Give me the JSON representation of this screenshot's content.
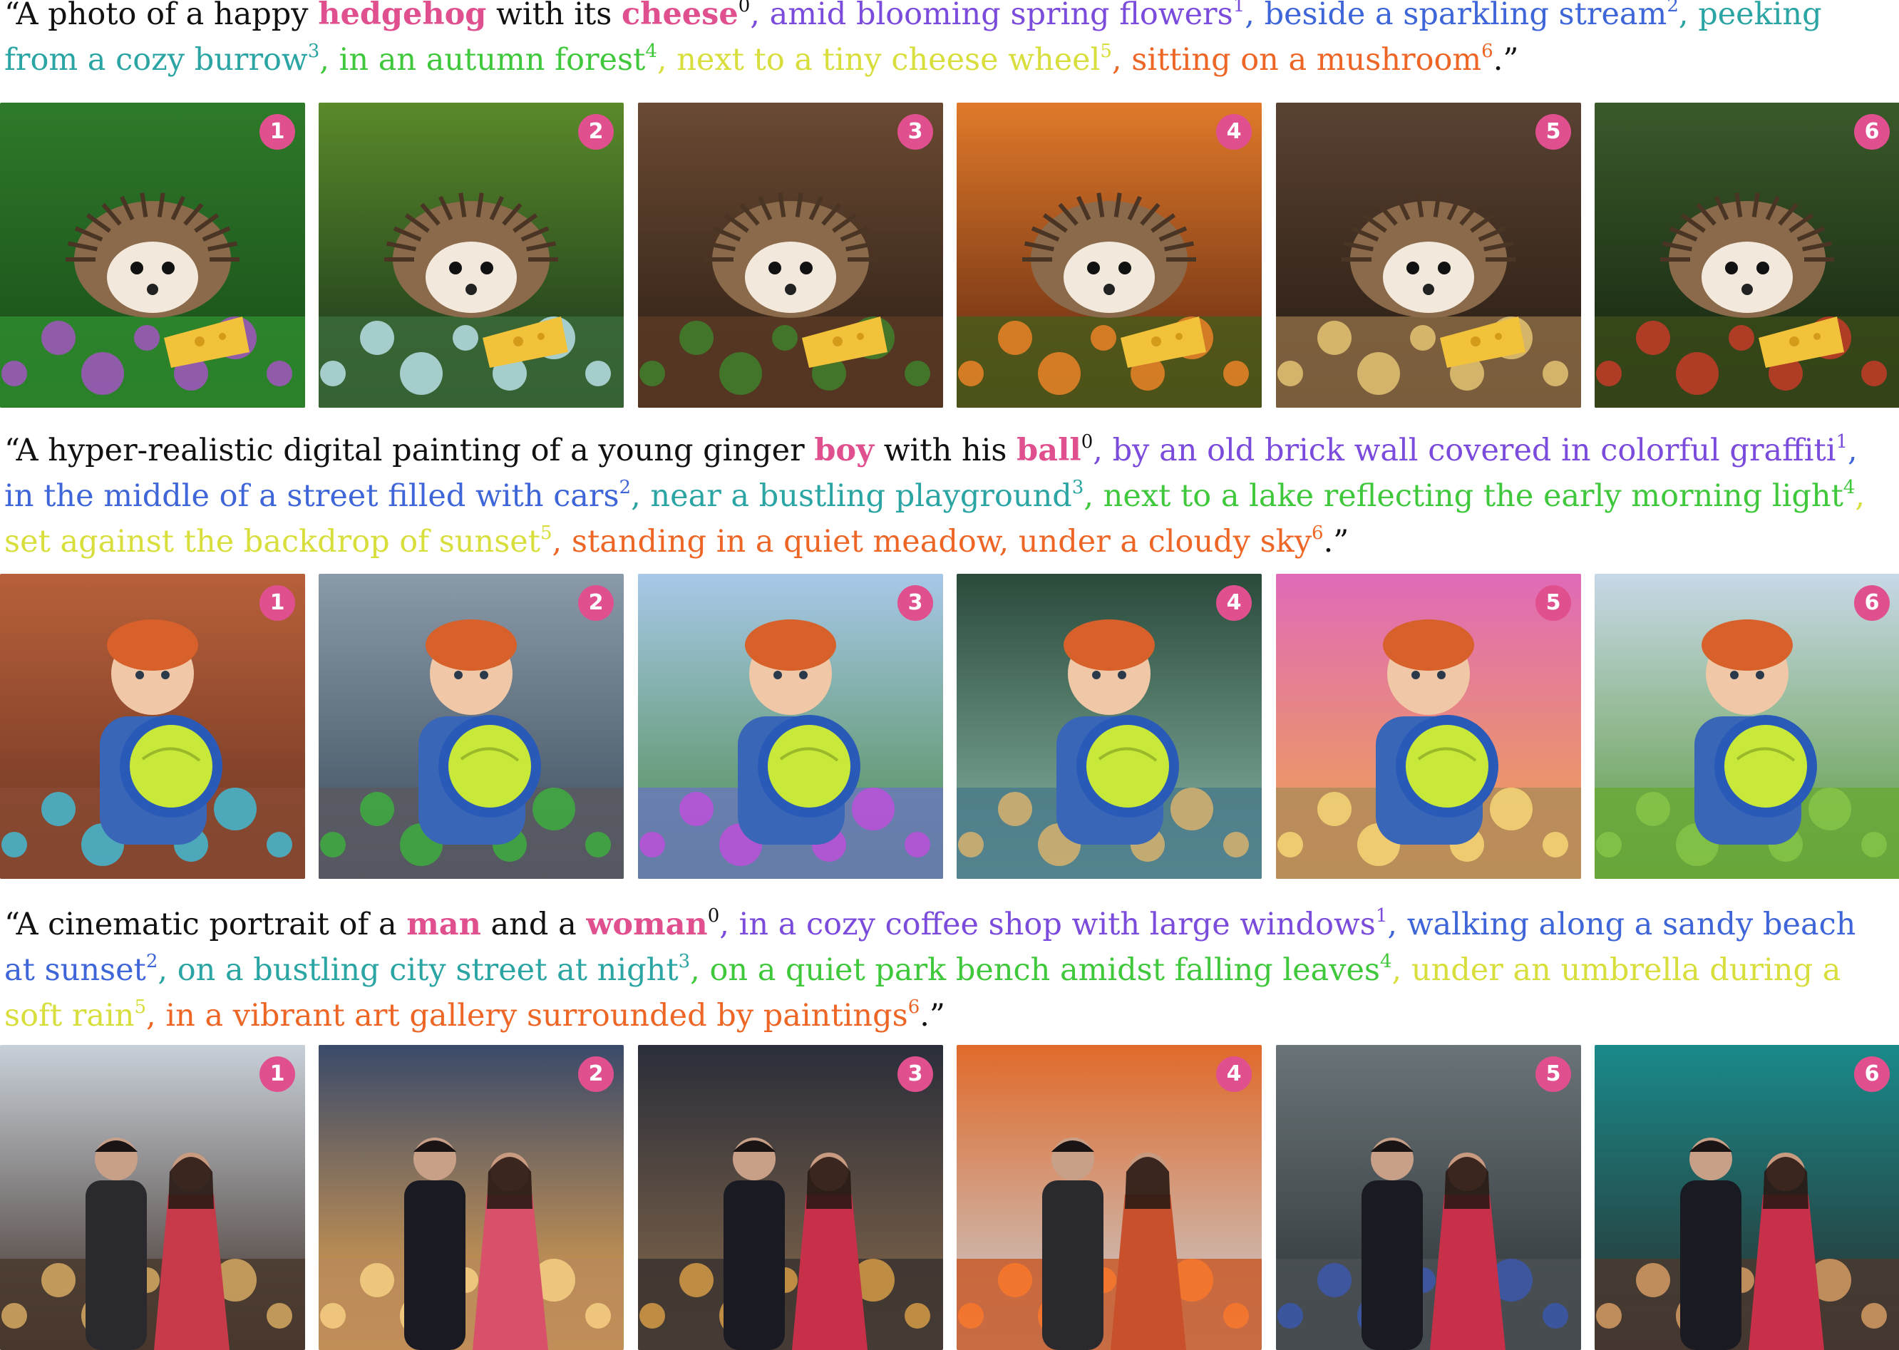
{
  "badge_color": "#e0508f",
  "segment_colors": [
    "#111111",
    "#7b4bdc",
    "#3f66d8",
    "#2aa5a3",
    "#40c83c",
    "#d8de3c",
    "#ee6626"
  ],
  "prompts": [
    {
      "open": "“A photo of a happy ",
      "subject1": "hedgehog",
      "mid": " with its ",
      "subject2": "cheese",
      "sup0": "0",
      "scenes": [
        {
          "text": ", amid blooming spring flowers",
          "num": "1"
        },
        {
          "text": ", beside a sparkling stream",
          "num": "2"
        },
        {
          "text": ", peeking from a cozy burrow",
          "num": "3"
        },
        {
          "text": ", in an autumn forest",
          "num": "4"
        },
        {
          "text": ", next to a tiny cheese wheel",
          "num": "5"
        },
        {
          "text": ", sitting on a mushroom",
          "num": "6"
        }
      ],
      "close": ".”"
    },
    {
      "open": "“A hyper-realistic digital painting of a young ginger ",
      "subject1": "boy",
      "mid": " with his ",
      "subject2": "ball",
      "sup0": "0",
      "scenes": [
        {
          "text": ", by an old brick wall covered in colorful graffiti",
          "num": "1"
        },
        {
          "text": ", in the middle of a street filled with cars",
          "num": "2"
        },
        {
          "text": ", near a bustling playground",
          "num": "3"
        },
        {
          "text": ", next to a lake reflecting the early morning light",
          "num": "4"
        },
        {
          "text": ", set against the backdrop of sunset",
          "num": "5"
        },
        {
          "text": ", standing in a quiet meadow, under a cloudy sky",
          "num": "6"
        }
      ],
      "close": ".”"
    },
    {
      "open": "“A cinematic portrait of a ",
      "subject1": "man",
      "mid": " and a ",
      "subject2": "woman",
      "sup0": "0",
      "scenes": [
        {
          "text": ", in a cozy coffee shop with large windows",
          "num": "1"
        },
        {
          "text": ", walking along a sandy beach at sunset",
          "num": "2"
        },
        {
          "text": ", on a bustling city street at night",
          "num": "3"
        },
        {
          "text": ", on a quiet park bench amidst falling leaves",
          "num": "4"
        },
        {
          "text": ", under an umbrella during a soft rain",
          "num": "5"
        },
        {
          "text": ", in a vibrant art gallery surrounded by paintings",
          "num": "6"
        }
      ],
      "close": ".”"
    }
  ],
  "rows": [
    {
      "tiles": [
        {
          "badge": "1",
          "subject": "hedgehog-icon",
          "scene": "spring flowers",
          "bg": [
            "#2f7a2a",
            "#174a18"
          ],
          "accent": "#b34fd6",
          "ground": "#2e8b2e",
          "figure": "#8a6a4a",
          "prop": "#f2c23a"
        },
        {
          "badge": "2",
          "subject": "hedgehog-icon",
          "scene": "sparkling stream",
          "bg": [
            "#5a8a2a",
            "#16301a"
          ],
          "accent": "#c9f0ff",
          "ground": "#3c6b3a",
          "figure": "#8a6a4a",
          "prop": "#f2c23a"
        },
        {
          "badge": "3",
          "subject": "hedgehog-icon",
          "scene": "cozy burrow",
          "bg": [
            "#6a4a32",
            "#2a1c14"
          ],
          "accent": "#3c8a2e",
          "ground": "#5a3a24",
          "figure": "#8a6a4a",
          "prop": "#f2c23a"
        },
        {
          "badge": "4",
          "subject": "hedgehog-icon",
          "scene": "autumn forest",
          "bg": [
            "#e07a2a",
            "#5a2410"
          ],
          "accent": "#ff8a2a",
          "ground": "#4a5a1a",
          "figure": "#8a6a4a",
          "prop": "#f2c23a"
        },
        {
          "badge": "5",
          "subject": "hedgehog-icon",
          "scene": "cheese wheel",
          "bg": [
            "#5a4232",
            "#241810"
          ],
          "accent": "#f2d27a",
          "ground": "#8a6a44",
          "figure": "#8a6a4a",
          "prop": "#f2c23a"
        },
        {
          "badge": "6",
          "subject": "hedgehog-icon",
          "scene": "mushroom",
          "bg": [
            "#3a5a2a",
            "#14200e"
          ],
          "accent": "#d83a2a",
          "ground": "#3a4a1a",
          "figure": "#8a6a4a",
          "prop": "#f2c23a"
        }
      ]
    },
    {
      "tiles": [
        {
          "badge": "1",
          "subject": "boy-icon",
          "scene": "graffiti wall",
          "bg": [
            "#b8603a",
            "#6a3422"
          ],
          "accent": "#3ac8e8",
          "ground": "#8a4a32",
          "figure": "#3a66b8",
          "prop": "#c8e83a"
        },
        {
          "badge": "2",
          "subject": "boy-icon",
          "scene": "street with cars",
          "bg": [
            "#8a9aa8",
            "#3a4a5a"
          ],
          "accent": "#3ab83a",
          "ground": "#5a5a62",
          "figure": "#3a66b8",
          "prop": "#c8e83a"
        },
        {
          "badge": "3",
          "subject": "boy-icon",
          "scene": "playground",
          "bg": [
            "#a8c8e8",
            "#4a8a4a"
          ],
          "accent": "#c84ae0",
          "ground": "#6a7ab8",
          "figure": "#3a66b8",
          "prop": "#c8e83a"
        },
        {
          "badge": "4",
          "subject": "boy-icon",
          "scene": "lake morning",
          "bg": [
            "#2a4a3a",
            "#8ab8a8"
          ],
          "accent": "#e8b86a",
          "ground": "#4a7a8a",
          "figure": "#3a66b8",
          "prop": "#c8e83a"
        },
        {
          "badge": "5",
          "subject": "boy-icon",
          "scene": "sunset",
          "bg": [
            "#e06ab8",
            "#f0a84a"
          ],
          "accent": "#ffe07a",
          "ground": "#b08a5a",
          "figure": "#3a66b8",
          "prop": "#c8e83a"
        },
        {
          "badge": "6",
          "subject": "boy-icon",
          "scene": "quiet meadow",
          "bg": [
            "#c8d8e8",
            "#5a9a3a"
          ],
          "accent": "#8ac84a",
          "ground": "#6aa83a",
          "figure": "#3a66b8",
          "prop": "#c8e83a"
        }
      ]
    },
    {
      "tiles": [
        {
          "badge": "1",
          "subject": "couple-icon",
          "scene": "coffee shop",
          "bg": [
            "#c8d0d8",
            "#3a2a22"
          ],
          "accent": "#e8b86a",
          "ground": "#4a3a2e",
          "figure": "#2a2a2e",
          "prop": "#c83a4a"
        },
        {
          "badge": "2",
          "subject": "couple-icon",
          "scene": "beach sunset",
          "bg": [
            "#3a4a6a",
            "#f0a84a"
          ],
          "accent": "#ffd88a",
          "ground": "#b88a5a",
          "figure": "#1a1a22",
          "prop": "#d8506a"
        },
        {
          "badge": "3",
          "subject": "couple-icon",
          "scene": "city street night",
          "bg": [
            "#2a2e3a",
            "#8a6a4a"
          ],
          "accent": "#e8a84a",
          "ground": "#3a3230",
          "figure": "#1a1a22",
          "prop": "#c8304a"
        },
        {
          "badge": "4",
          "subject": "couple-icon",
          "scene": "park bench",
          "bg": [
            "#e06a2a",
            "#c8d0d8"
          ],
          "accent": "#ff7a2a",
          "ground": "#c85a2a",
          "figure": "#2a2a2e",
          "prop": "#c8502a"
        },
        {
          "badge": "5",
          "subject": "couple-icon",
          "scene": "soft rain",
          "bg": [
            "#6a7478",
            "#2a3032"
          ],
          "accent": "#3a5ab8",
          "ground": "#4a5054",
          "figure": "#1a1a22",
          "prop": "#c8304a"
        },
        {
          "badge": "6",
          "subject": "couple-icon",
          "scene": "art gallery",
          "bg": [
            "#1a8a8a",
            "#2a2a2a"
          ],
          "accent": "#e8a86a",
          "ground": "#4a3a30",
          "figure": "#1a1a22",
          "prop": "#c8304a"
        }
      ]
    }
  ]
}
